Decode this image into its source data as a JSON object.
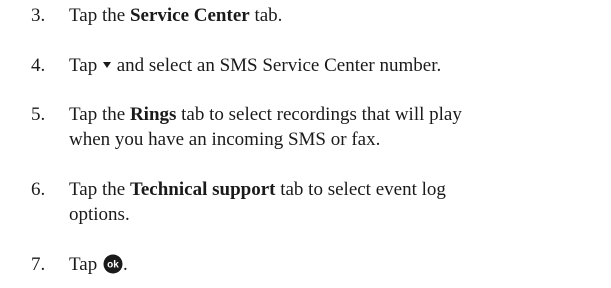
{
  "steps": [
    {
      "num": "3.",
      "pre": "Tap the ",
      "bold": "Service Center",
      "post": " tab."
    },
    {
      "num": "4.",
      "pre": "Tap ",
      "icon": "dropdown-arrow-icon",
      "post": " and select an SMS Service Center number."
    },
    {
      "num": "5.",
      "pre": "Tap the ",
      "bold": "Rings",
      "post": " tab to select recordings that will play",
      "line2": "when you have an incoming SMS or fax."
    },
    {
      "num": "6.",
      "pre": "Tap the ",
      "bold": "Technical support",
      "post": " tab to select event log",
      "line2": "options."
    },
    {
      "num": "7.",
      "pre": "Tap ",
      "icon": "ok-icon",
      "post": ".",
      "icon_text": "ok"
    }
  ]
}
